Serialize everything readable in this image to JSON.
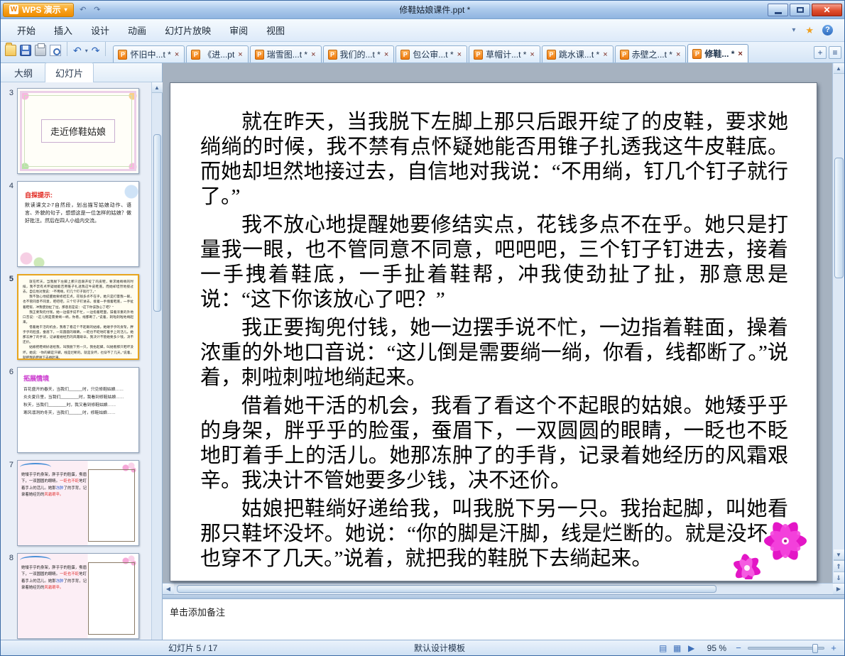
{
  "window": {
    "app_button": "WPS 演示",
    "title": "修鞋姑娘课件.ppt *"
  },
  "glyphs": {
    "wps_logo": "W",
    "app_arrow": "▾",
    "close": "✕",
    "tab_close": "×",
    "doc": "P",
    "undo": "↶",
    "redo": "↷",
    "mini_arrow": "▾",
    "menu_chevron": "▾",
    "star": "★",
    "help": "?",
    "up": "▲",
    "down": "▼",
    "left": "◀",
    "right": "▶",
    "prev_slide": "⇑",
    "next_slide": "⇓",
    "add_tab": "+",
    "tab_list": "≡",
    "view_normal": "▤",
    "view_sorter": "▦",
    "view_show": "▶",
    "zoom_out": "−",
    "zoom_in": "+"
  },
  "menu": {
    "items": [
      {
        "label": "开始"
      },
      {
        "label": "插入"
      },
      {
        "label": "设计"
      },
      {
        "label": "动画"
      },
      {
        "label": "幻灯片放映"
      },
      {
        "label": "审阅"
      },
      {
        "label": "视图"
      }
    ]
  },
  "doc_tabs": [
    {
      "label": "怀旧中...t *"
    },
    {
      "label": "《进...pt"
    },
    {
      "label": "瑞雪图...t *"
    },
    {
      "label": "我们的...t *"
    },
    {
      "label": "包公审...t *"
    },
    {
      "label": "草帽计...t *"
    },
    {
      "label": "跳水课...t *"
    },
    {
      "label": "赤壁之...t *"
    },
    {
      "label": "修鞋... *"
    }
  ],
  "sidebar": {
    "tabs": [
      {
        "label": "大纲"
      },
      {
        "label": "幻灯片"
      }
    ],
    "slides": [
      {
        "num": "3",
        "title": "走近修鞋姑娘"
      },
      {
        "num": "4",
        "heading": "自探提示:",
        "body": "默读课文2-7自然段，划出描写姑娘动作、语言、外貌的句子，想想这是一位怎样的姑娘？做好批注。然后在四人小组内交流。"
      },
      {
        "num": "5"
      },
      {
        "num": "6",
        "heading": "拓展情境",
        "lines": [
          "百花盛开的春天，当我们______时，只见修鞋姑娘……",
          "炎炎夏日里，当我们________时，我看到修鞋姑娘……",
          "秋天，当我们________时，我又看到修鞋姑娘……",
          "寒风凛冽的冬天，当我们______时，修鞋姑娘……"
        ]
      },
      {
        "num": "7",
        "segments": [
          {
            "text": "她矮乎乎的身架，胖乎乎的脸蛋，蚕眉下，一双圆圆的眼睛。"
          },
          {
            "text": "一眨也不眨"
          },
          {
            "text": "地盯着手上的活儿。她那"
          },
          {
            "text": "冻肿"
          },
          {
            "text": "了的手背，记录着她经历的"
          },
          {
            "text": "风霜艰辛。"
          }
        ]
      },
      {
        "num": "8",
        "segments": [
          {
            "text": "她矮乎乎的身架，胖乎乎的脸蛋，蚕眉下，一双圆圆的眼睛。"
          },
          {
            "text": "一眨也不眨"
          },
          {
            "text": "地盯着手上的活儿。她那"
          },
          {
            "text": "冻肿"
          },
          {
            "text": "了的手背，记录着她经历的"
          },
          {
            "text": "风霜艰辛。"
          }
        ]
      }
    ]
  },
  "slide": {
    "paragraphs": [
      "就在昨天，当我脱下左脚上那只后跟开绽了的皮鞋，要求她绱绱的时候，我不禁有点怀疑她能否用锥子扎透我这牛皮鞋底。而她却坦然地接过去，自信地对我说：“不用绱，钉几个钉子就行了。”",
      "我不放心地提醒她要修结实点，花钱多点不在乎。她只是打量我一眼，也不管同意不同意，吧吧吧，三个钉子钉进去，接着一手拽着鞋底，一手扯着鞋帮，冲我使劲扯了扯，那意思是说：“这下你该放心了吧？”",
      "我正要掏兜付钱，她一边摆手说不忙，一边指着鞋面，操着浓重的外地口音说：“这儿倒是需要绱一绱，你看，线都断了。”说着，刺啦刺啦地绱起来。",
      "借着她干活的机会，我看了看这个不起眼的姑娘。她矮乎乎的身架，胖乎乎的脸蛋，蚕眉下，一双圆圆的眼睛，一眨也不眨地盯着手上的活儿。她那冻肿了的手背，记录着她经历的风霜艰辛。我决计不管她要多少钱，决不还价。",
      "姑娘把鞋绱好递给我，叫我脱下另一只。我抬起脚，叫她看那只鞋坏没坏。她说：“你的脚是汗脚，线是烂断的。就是没坏，也穿不了几天。”说着，就把我的鞋脱下去绱起来。"
    ]
  },
  "notes": {
    "placeholder": "单击添加备注"
  },
  "status": {
    "slide_info": "幻灯片 5 / 17",
    "template": "默认设计模板",
    "zoom": "95 %"
  },
  "colors": {
    "app_button_orange": "#f59a00",
    "close_button_red": "#d43828",
    "thumb4_heading_red": "#e02018",
    "thumb6_heading_magenta": "#cf3fd0",
    "thumb_highlight_red": "#e03030",
    "thumb_highlight_blue": "#3060d0",
    "selected_thumb_border": "#e8a51e",
    "flower_magenta": "#e316c6",
    "canvas_gray": "#a6b2c0"
  }
}
